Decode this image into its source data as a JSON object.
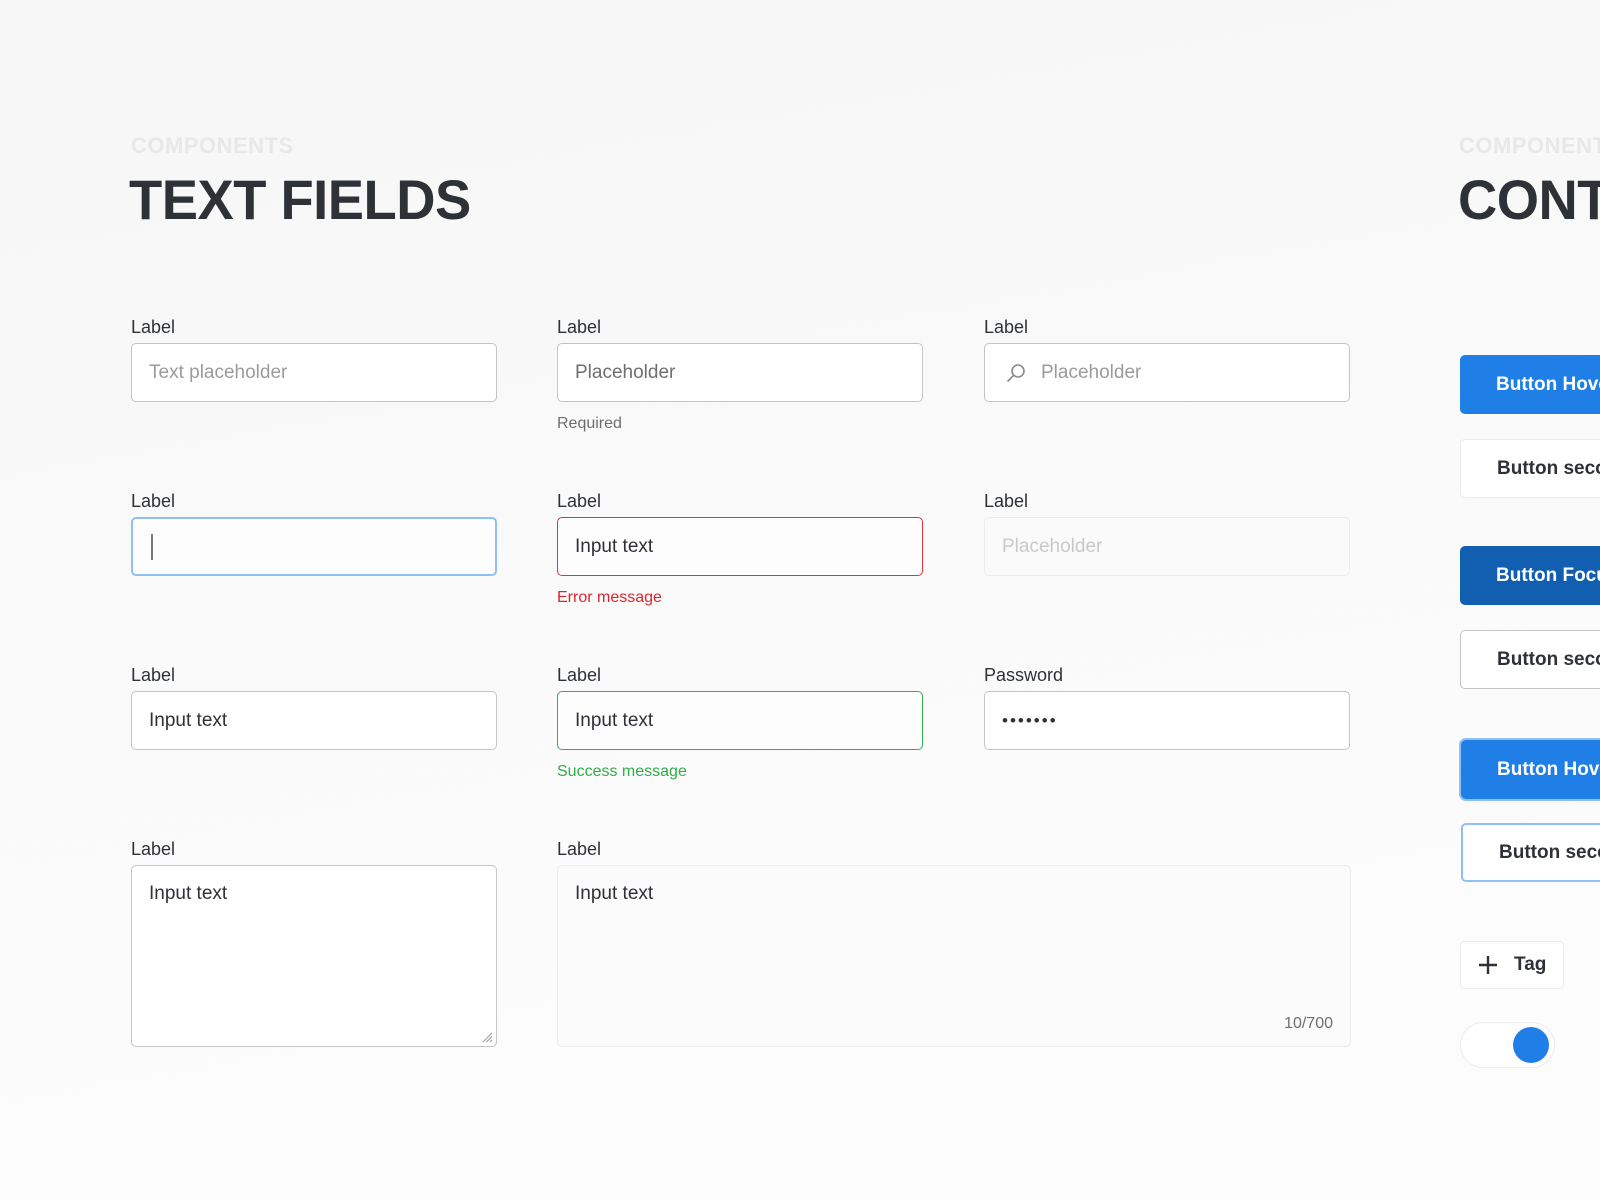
{
  "sections": {
    "text_fields": {
      "eyebrow": "COMPONENTS",
      "title": "TEXT FIELDS"
    },
    "controls": {
      "eyebrow": "COMPONENTS",
      "title": "CONTROLS"
    }
  },
  "fields": {
    "basic": {
      "label": "Label",
      "placeholder": "Text placeholder"
    },
    "required": {
      "label": "Label",
      "placeholder": "Placeholder",
      "helper": "Required"
    },
    "search": {
      "label": "Label",
      "placeholder": "Placeholder",
      "icon": "search-icon"
    },
    "focused": {
      "label": "Label",
      "value": ""
    },
    "error": {
      "label": "Label",
      "value": "Input text",
      "helper": "Error message"
    },
    "disabled": {
      "label": "Label",
      "placeholder": "Placeholder"
    },
    "filled": {
      "label": "Label",
      "value": "Input text"
    },
    "success": {
      "label": "Label",
      "value": "Input text",
      "helper": "Success message"
    },
    "password": {
      "label": "Password",
      "value": "•••••••"
    },
    "textarea": {
      "label": "Label",
      "value": "Input text"
    },
    "textarea_counter": {
      "label": "Label",
      "value": "Input text",
      "counter": "10/700"
    }
  },
  "controls": {
    "buttons": [
      {
        "label": "Button Hover",
        "variant": "primary"
      },
      {
        "label": "Button secondary",
        "variant": "secondary"
      },
      {
        "label": "Button Focus",
        "variant": "primary-focus"
      },
      {
        "label": "Button secondary",
        "variant": "secondary-outline"
      },
      {
        "label": "Button Hover",
        "variant": "primary-ring"
      },
      {
        "label": "Button secondary",
        "variant": "secondary-ring"
      }
    ],
    "tag": {
      "label": "Tag",
      "icon": "plus-icon"
    },
    "toggle": {
      "state": "on"
    }
  },
  "colors": {
    "primary": "#1f7fe6",
    "primary_focus": "#125fb2",
    "focus_ring": "#8ebff5",
    "error": "#e0242c",
    "success": "#2fae47",
    "text": "#2e3136"
  }
}
